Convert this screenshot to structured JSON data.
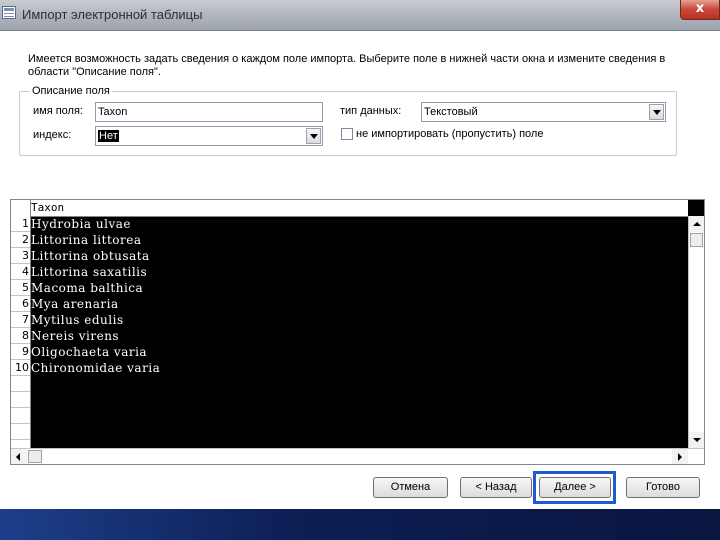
{
  "window": {
    "title": "Импорт электронной таблицы",
    "close_label": "x"
  },
  "info_text": "Имеется возможность задать сведения о каждом поле импорта. Выберите поле в нижней части окна и измените сведения в области \"Описание поля\".",
  "field_desc": {
    "legend": "Описание поля",
    "field_name_label": "имя поля:",
    "field_name_value": "Taxon",
    "data_type_label": "тип данных:",
    "data_type_value": "Текстовый",
    "index_label": "индекс:",
    "index_value": "Нет",
    "skip_label": "не импортировать (пропустить) поле"
  },
  "grid": {
    "header": "Taxon",
    "rows": [
      {
        "n": "1",
        "v": "Hydrobia ulvae"
      },
      {
        "n": "2",
        "v": "Littorina littorea"
      },
      {
        "n": "3",
        "v": "Littorina obtusata"
      },
      {
        "n": "4",
        "v": "Littorina saxatilis"
      },
      {
        "n": "5",
        "v": "Macoma balthica"
      },
      {
        "n": "6",
        "v": "Mya arenaria"
      },
      {
        "n": "7",
        "v": "Mytilus edulis"
      },
      {
        "n": "8",
        "v": "Nereis virens"
      },
      {
        "n": "9",
        "v": "Oligochaeta varia"
      },
      {
        "n": "10",
        "v": "Chironomidae varia"
      }
    ]
  },
  "buttons": {
    "cancel": "Отмена",
    "back": "< Назад",
    "next": "Далее >",
    "finish": "Готово"
  },
  "colors": {
    "focus": "#1e5bd1",
    "grid_background": "#000000",
    "taskbar": "#0d1f55"
  }
}
